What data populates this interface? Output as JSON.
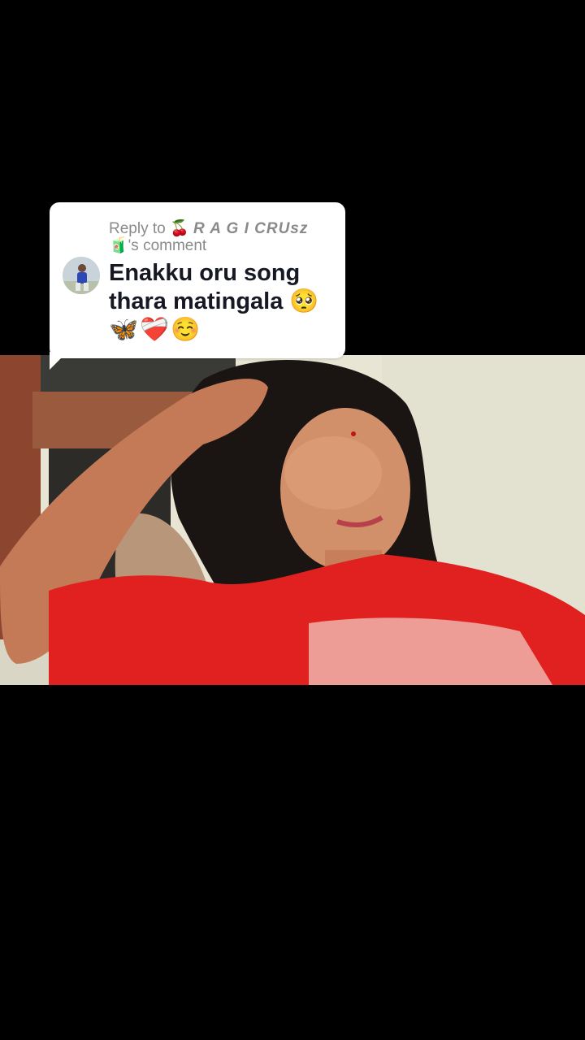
{
  "video": {
    "description_icon": "video-frame-photo"
  },
  "reply_card": {
    "reply_prefix": "Reply to",
    "username_emoji_left": "🍒",
    "username": "R A G I  CRUsz",
    "username_emoji_right": "🧃",
    "reply_suffix": "'s comment",
    "comment_text": "Enakku oru song thara matingala 🥺",
    "comment_emojis": "🦋❤️‍🩹☺️",
    "avatar_icon": "user-avatar-icon"
  },
  "colors": {
    "background": "#000000",
    "card_background": "#ffffff",
    "header_text": "#8a8a8a",
    "comment_text": "#161823",
    "shirt_red": "#e0211f"
  }
}
